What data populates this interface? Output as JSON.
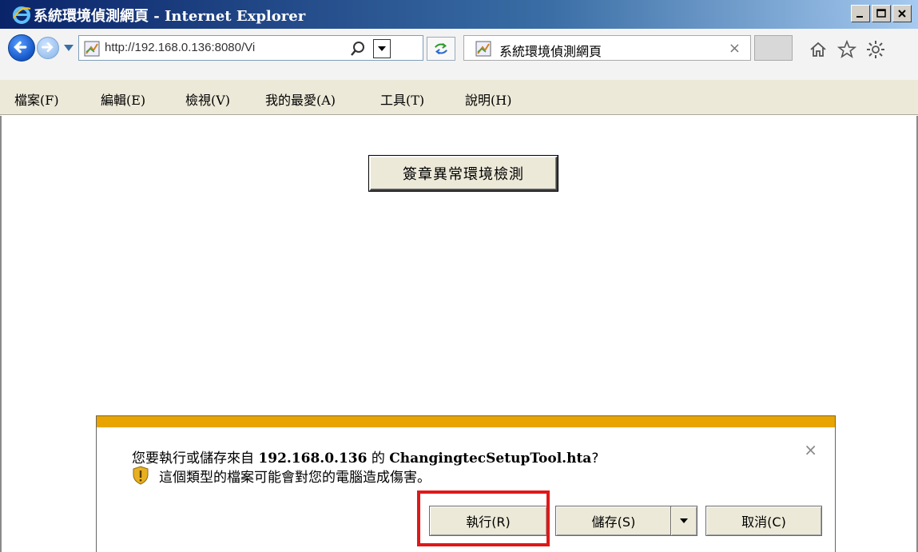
{
  "window": {
    "title": "系統環境偵測網頁 - Internet Explorer"
  },
  "navbar": {
    "address": "http://192.168.0.136:8080/Vi",
    "tab_title": "系統環境偵測網頁",
    "tab_close": "×"
  },
  "menu": [
    "檔案(F)",
    "編輯(E)",
    "檢視(V)",
    "我的最愛(A)",
    "工具(T)",
    "說明(H)"
  ],
  "page": {
    "button_label": "簽章異常環境檢測"
  },
  "download_bar": {
    "prompt_prefix": "您要執行或儲存來自 ",
    "host": "192.168.0.136",
    "prompt_mid": " 的 ",
    "filename": "ChangingtecSetupTool.hta",
    "prompt_suffix": "?",
    "warning": "這個類型的檔案可能會對您的電腦造成傷害。",
    "close": "×",
    "run_label": "執行(R)",
    "save_label": "儲存(S)",
    "cancel_label": "取消(C)",
    "accent_color": "#e8a400"
  },
  "highlight_color": "#e01818"
}
